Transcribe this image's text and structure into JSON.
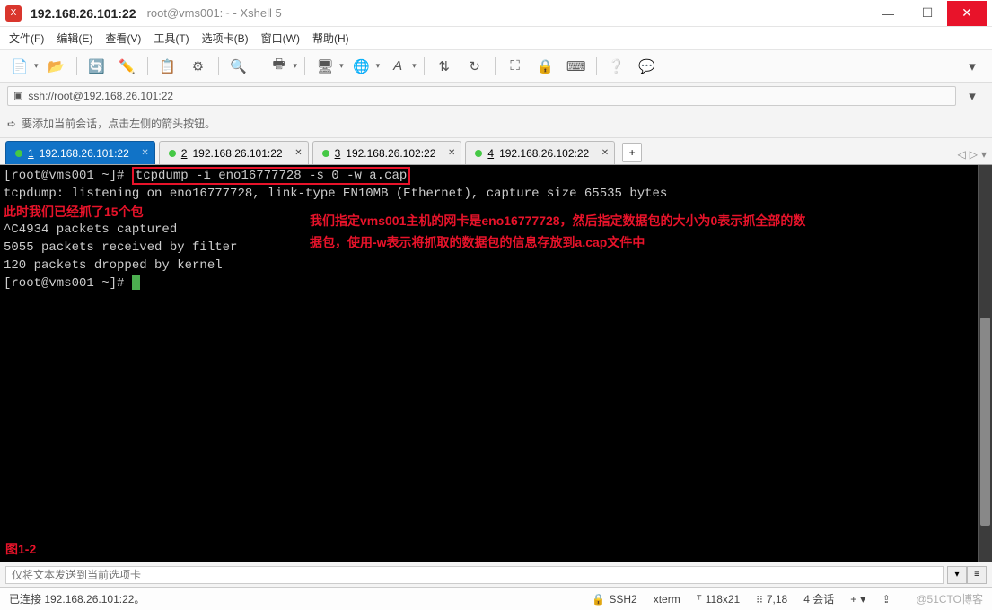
{
  "titlebar": {
    "ip": "192.168.26.101:22",
    "subtitle": "root@vms001:~ - Xshell 5"
  },
  "menu": {
    "file": "文件(F)",
    "edit": "编辑(E)",
    "view": "查看(V)",
    "tools": "工具(T)",
    "tabs": "选项卡(B)",
    "window": "窗口(W)",
    "help": "帮助(H)"
  },
  "address": {
    "url": "ssh://root@192.168.26.101:22"
  },
  "hint": {
    "text": "要添加当前会话，点击左侧的箭头按钮。"
  },
  "tabs": [
    {
      "num": "1",
      "label": "192.168.26.101:22",
      "active": true
    },
    {
      "num": "2",
      "label": "192.168.26.101:22",
      "active": false
    },
    {
      "num": "3",
      "label": "192.168.26.102:22",
      "active": false
    },
    {
      "num": "4",
      "label": "192.168.26.102:22",
      "active": false
    }
  ],
  "terminal": {
    "prompt1_a": "[root@vms001 ~]#",
    "command": "tcpdump -i eno16777728 -s 0 -w a.cap",
    "line2": "tcpdump: listening on eno16777728, link-type EN10MB (Ethernet), capture size 65535 bytes",
    "line3": "^C4934 packets captured",
    "line4": "5055 packets received by filter",
    "line5": "120 packets dropped by kernel",
    "prompt2": "[root@vms001 ~]# ",
    "anno_left": "此时我们已经抓了15个包",
    "anno_right_l1": "我们指定vms001主机的网卡是eno16777728，然后指定数据包的大小为0表示抓全部的数",
    "anno_right_l2": "据包，使用-w表示将抓取的数据包的信息存放到a.cap文件中",
    "fig_label": "图1-2"
  },
  "sendbar": {
    "placeholder": "仅将文本发送到当前选项卡"
  },
  "status": {
    "conn": "已连接 192.168.26.101:22。",
    "proto": "SSH2",
    "term": "xterm",
    "size": "118x21",
    "pos": "7,18",
    "sess": "4 会话",
    "watermark": "@51CTO博客"
  },
  "icons": {
    "lock": "🔒",
    "arrow": "➪",
    "plus": "+",
    "caps": "⇪"
  }
}
